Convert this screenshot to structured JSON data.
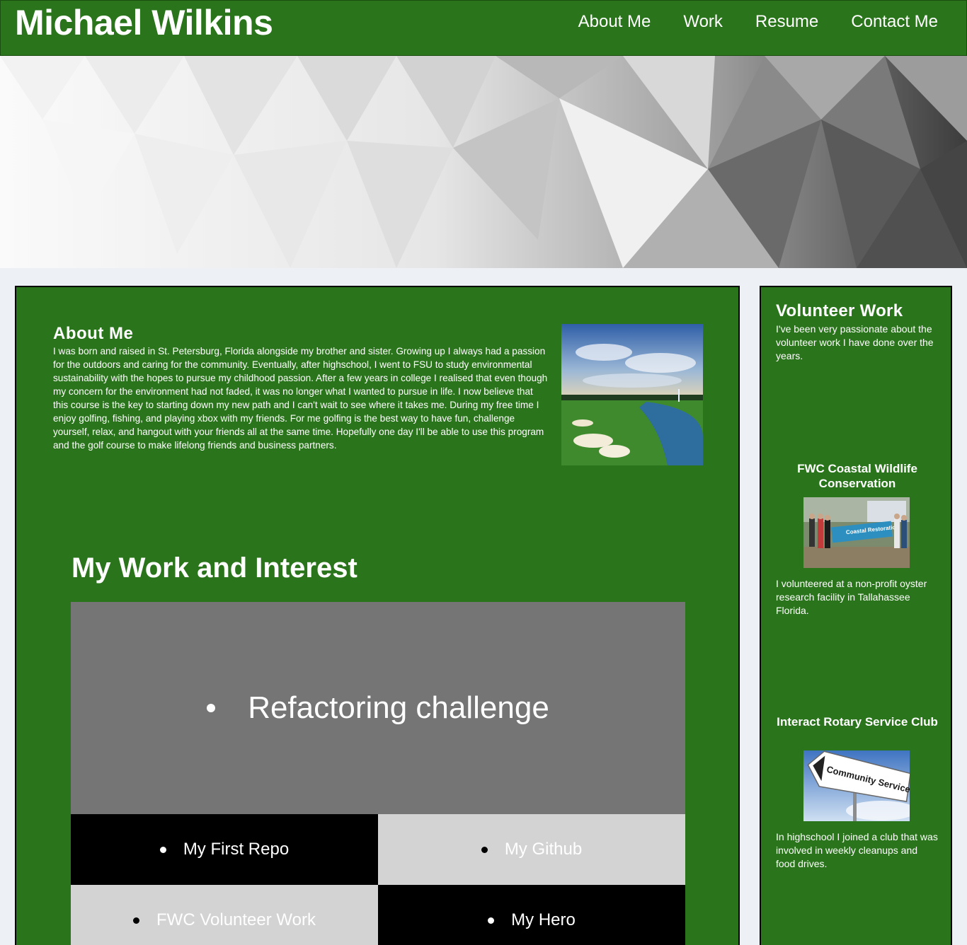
{
  "header": {
    "site_title": "Michael Wilkins",
    "nav": [
      "About Me",
      "Work",
      "Resume",
      "Contact Me"
    ]
  },
  "about": {
    "title": "About Me",
    "text": "I was born and raised in St. Petersburg, Florida alongside my brother and sister. Growing up I always had a passion for the outdoors and caring for the community. Eventually, after highschool, I went to FSU to study environmental sustainability with the hopes to pursue my childhood passion. After a few years in college I realised that even though my concern for the environment had not faded, it was no longer what I wanted to pursue in life. I now believe that this course is the key to starting down my new path and I can't wait to see where it takes me. During my free time I enjoy golfing, fishing, and playing xbox with my friends. For me golfing is the best way to have fun, challenge yourself, relax, and hangout with your friends all at the same time. Hopefully one day I'll be able to use this program and the golf course to make lifelong friends and business partners."
  },
  "work": {
    "title": "My Work and Interest",
    "featured": "Refactoring challenge",
    "tiles": [
      "My First Repo",
      "My Github",
      "FWC Volunteer Work",
      "My Hero"
    ]
  },
  "sidebar": {
    "title": "Volunteer Work",
    "intro": "I've been very passionate about the volunteer work I have done over the years.",
    "cards": [
      {
        "title": "FWC Coastal Wildlife Conservation",
        "banner_text": "Coastal Restoration",
        "text": "I volunteered at a non-profit oyster research facility in Tallahassee Florida."
      },
      {
        "title": "Interact Rotary Service Club",
        "sign_text": "Community Service",
        "text": "In highschool I joined a club that was involved in weekly cleanups and food drives."
      }
    ]
  },
  "colors": {
    "brand_green": "#2a751b",
    "page_bg": "#edf1f5",
    "featured_gray": "#757575",
    "tile_light": "#d3d3d3",
    "tile_dark": "#000000"
  }
}
